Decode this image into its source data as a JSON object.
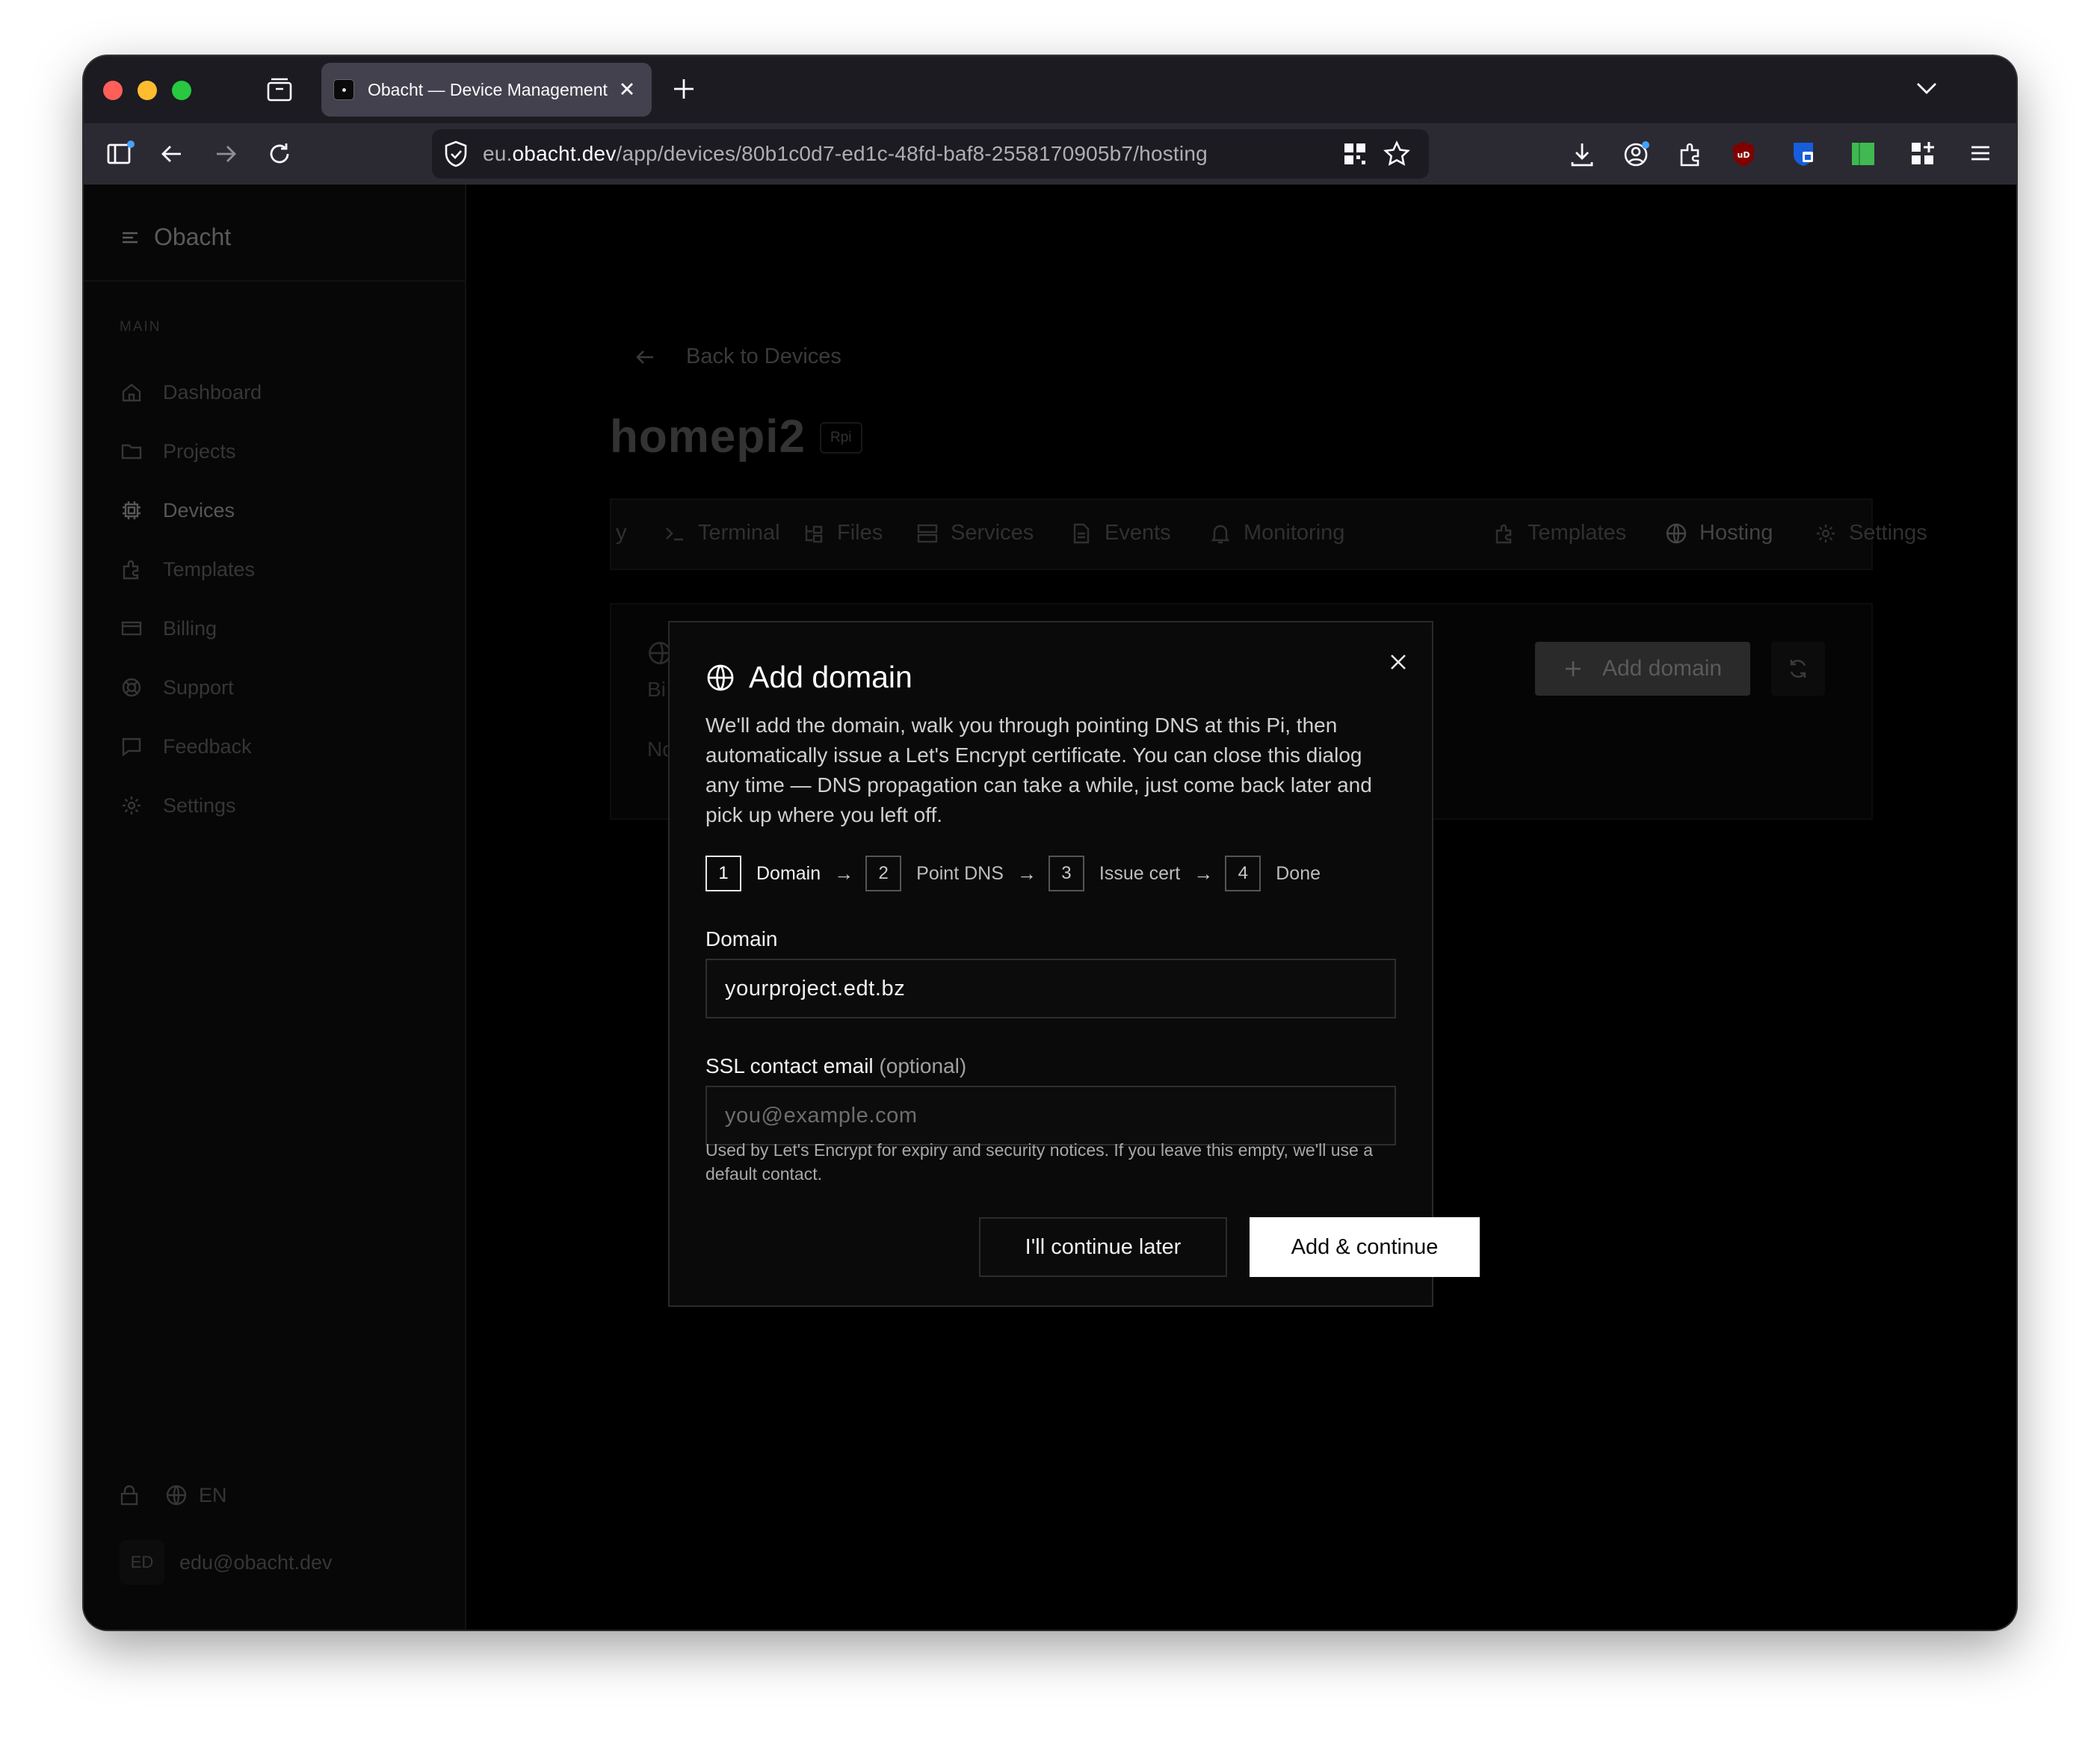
{
  "browser": {
    "tab_title": "Obacht — Device Management",
    "url_prefix": "eu.",
    "url_domain": "obacht.dev",
    "url_path": "/app/devices/80b1c0d7-ed1c-48fd-baf8-2558170905b7/hosting"
  },
  "sidebar": {
    "brand": "Obacht",
    "section_label": "MAIN",
    "items": [
      {
        "label": "Dashboard",
        "icon": "home-icon"
      },
      {
        "label": "Projects",
        "icon": "folder-icon"
      },
      {
        "label": "Devices",
        "icon": "chip-icon"
      },
      {
        "label": "Templates",
        "icon": "puzzle-icon"
      },
      {
        "label": "Billing",
        "icon": "card-icon"
      },
      {
        "label": "Support",
        "icon": "lifebuoy-icon"
      },
      {
        "label": "Feedback",
        "icon": "message-icon"
      },
      {
        "label": "Settings",
        "icon": "gear-icon"
      }
    ],
    "language": "EN",
    "user_initials": "ED",
    "user_email": "edu@obacht.dev"
  },
  "device": {
    "back_label": "Back to Devices",
    "name": "homepi2",
    "badge": "Rpi"
  },
  "device_tabs": {
    "partial": "y",
    "terminal": "Terminal",
    "files": "Files",
    "services": "Services",
    "events": "Events",
    "monitoring": "Monitoring",
    "templates": "Templates",
    "hosting": "Hosting",
    "settings": "Settings"
  },
  "hosting_panel": {
    "add_domain_label": "Add domain",
    "fragment_1": "Bi",
    "fragment_2": "No"
  },
  "modal": {
    "title": "Add domain",
    "description": "We'll add the domain, walk you through pointing DNS at this Pi, then automatically issue a Let's Encrypt certificate. You can close this dialog any time — DNS propagation can take a while, just come back later and pick up where you left off.",
    "steps": [
      {
        "number": "1",
        "label": "Domain"
      },
      {
        "number": "2",
        "label": "Point DNS"
      },
      {
        "number": "3",
        "label": "Issue cert"
      },
      {
        "number": "4",
        "label": "Done"
      }
    ],
    "step_arrow": "→",
    "domain_label": "Domain",
    "domain_value": "yourproject.edt.bz",
    "email_label": "SSL contact email",
    "email_optional": "(optional)",
    "email_placeholder": "you@example.com",
    "email_value": "",
    "help_text": "Used by Let's Encrypt for expiry and security notices. If you leave this empty, we'll use a default contact.",
    "secondary_button": "I'll continue later",
    "primary_button": "Add & continue"
  }
}
